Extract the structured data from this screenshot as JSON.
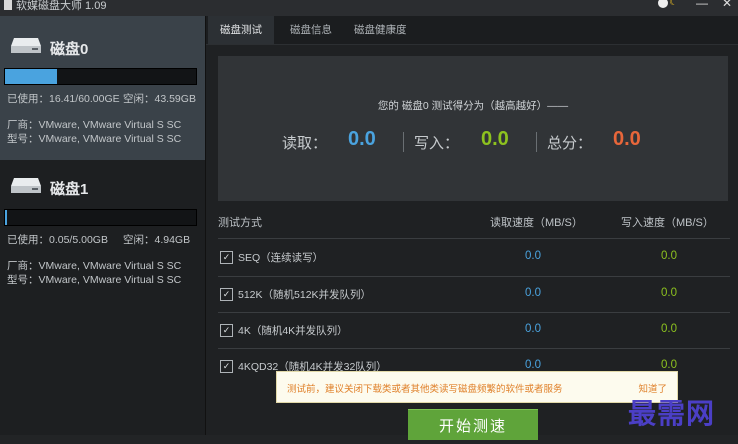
{
  "window": {
    "title": "软媒磁盘大师 1.09"
  },
  "sidebar": {
    "disks": [
      {
        "name": "磁盘0",
        "usage_fraction": 0.273,
        "used": "已使用：16.41/60.00GE",
        "free": "空闲：43.59GB",
        "vendor": "厂商：VMware, VMware Virtual S SC",
        "model": "型号：VMware, VMware Virtual S SC"
      },
      {
        "name": "磁盘1",
        "usage_fraction": 0.01,
        "used": "已使用：0.05/5.00GB",
        "free": "空闲：4.94GB",
        "vendor": "厂商：VMware, VMware Virtual S SC",
        "model": "型号：VMware, VMware Virtual S SC"
      }
    ]
  },
  "tabs": [
    "磁盘测试",
    "磁盘信息",
    "磁盘健康度"
  ],
  "score": {
    "caption": "您的 磁盘0 测试得分为（越高越好）——",
    "read_label": "读取：",
    "read_value": "0.0",
    "write_label": "写入：",
    "write_value": "0.0",
    "total_label": "总分：",
    "total_value": "0.0"
  },
  "table": {
    "headers": {
      "method": "测试方式",
      "read": "读取速度（MB/S）",
      "write": "写入速度（MB/S）"
    },
    "rows": [
      {
        "label": "SEQ（连续读写）",
        "read": "0.0",
        "write": "0.0"
      },
      {
        "label": "512K（随机512K并发队列）",
        "read": "0.0",
        "write": "0.0"
      },
      {
        "label": "4K（随机4K并发队列）",
        "read": "0.0",
        "write": "0.0"
      },
      {
        "label": "4KQD32（随机4K并发32队列）",
        "read": "0.0",
        "write": "0.0"
      }
    ]
  },
  "tip": {
    "text": "测试前，建议关闭下载类或者其他类读写磁盘频繁的软件或者服务",
    "dismiss": "知道了"
  },
  "start_button": "开始测速",
  "watermark": "最需网",
  "colors": {
    "read": "#4aa3df",
    "write": "#8dc21f",
    "total": "#e8663a",
    "start": "#5fa43a",
    "tip_text": "#e0802a"
  }
}
